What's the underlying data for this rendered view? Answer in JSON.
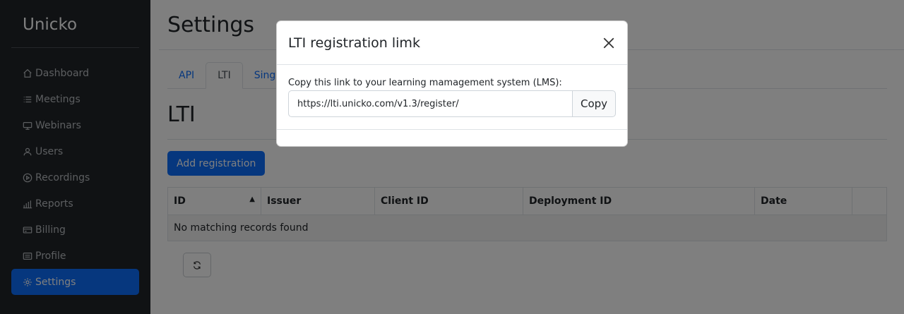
{
  "sidebar": {
    "brand": "Unicko",
    "items": [
      {
        "label": "Dashboard",
        "icon": "house-icon"
      },
      {
        "label": "Meetings",
        "icon": "list-icon"
      },
      {
        "label": "Webinars",
        "icon": "monitor-icon"
      },
      {
        "label": "Users",
        "icon": "person-icon"
      },
      {
        "label": "Recordings",
        "icon": "play-circle-icon"
      },
      {
        "label": "Reports",
        "icon": "bar-chart-icon"
      },
      {
        "label": "Billing",
        "icon": "credit-card-icon"
      },
      {
        "label": "Profile",
        "icon": "card-icon"
      },
      {
        "label": "Settings",
        "icon": "gear-icon",
        "active": true
      }
    ]
  },
  "main": {
    "title": "Settings",
    "tabs": [
      {
        "label": "API"
      },
      {
        "label": "LTI",
        "active": true
      },
      {
        "label": "Single"
      }
    ],
    "section_title": "LTI",
    "add_button": "Add registration",
    "table": {
      "columns": [
        "ID",
        "Issuer",
        "Client ID",
        "Deployment ID",
        "Date",
        ""
      ],
      "empty_message": "No matching records found"
    }
  },
  "modal": {
    "title": "LTI registration limk",
    "label": "Copy this link to your learning mamagement system (LMS):",
    "link_value": "https://lti.unicko.com/v1.3/register/",
    "copy_label": "Copy"
  },
  "colors": {
    "sidebar_bg": "#212529",
    "accent": "#0d6efd"
  }
}
